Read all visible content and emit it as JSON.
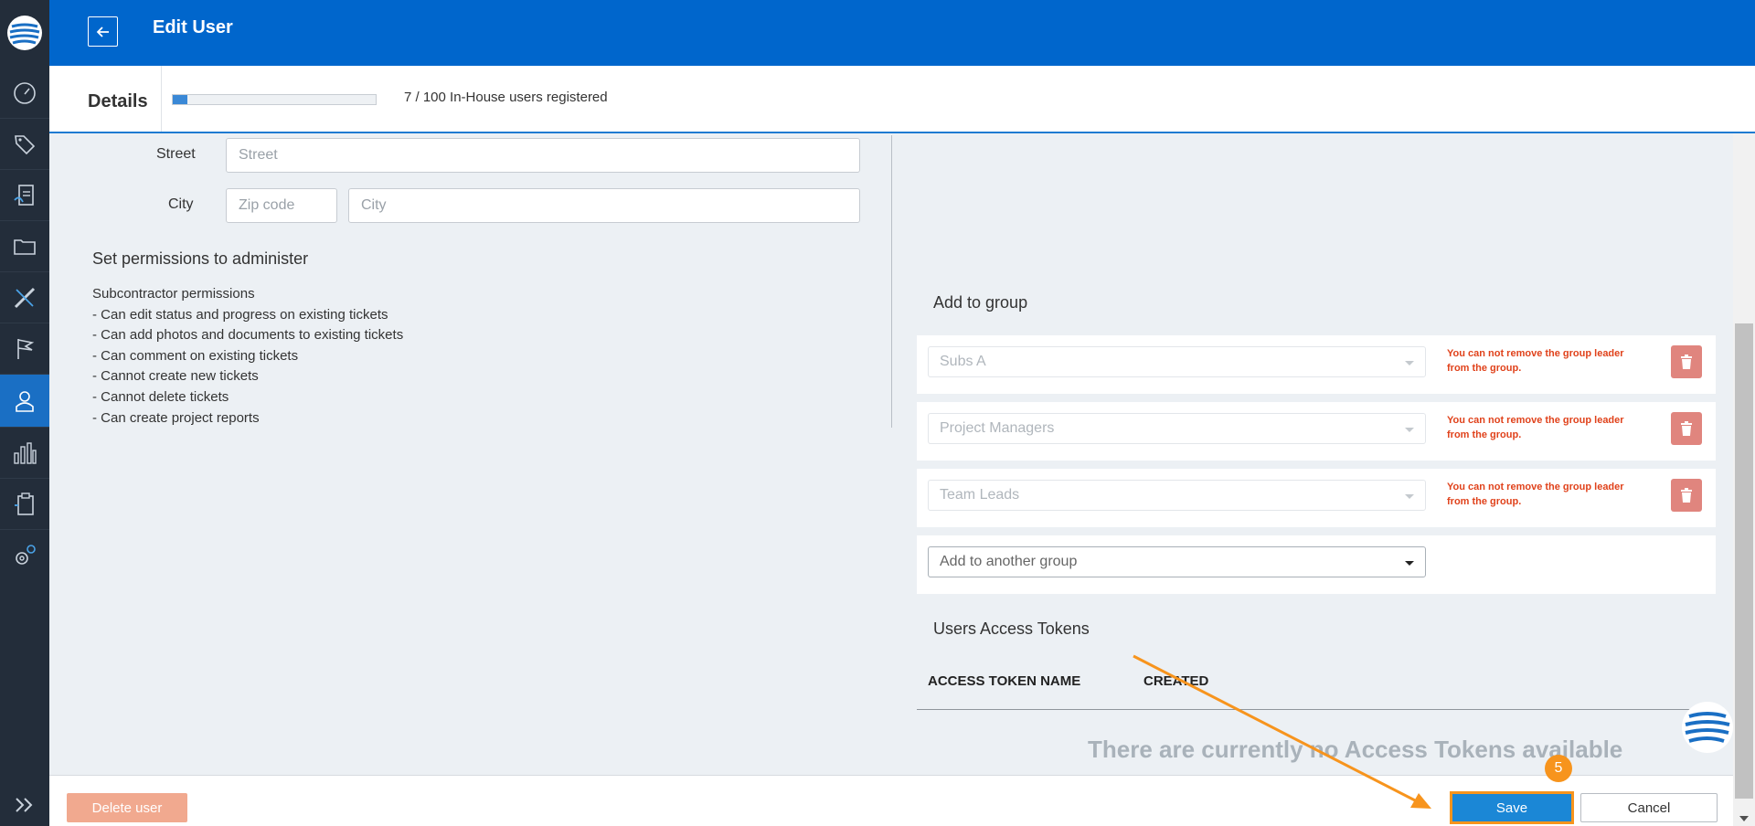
{
  "sidebar": {
    "items": [
      {
        "icon": "dashboard-gauge-icon"
      },
      {
        "icon": "tags-icon"
      },
      {
        "icon": "plans-document-icon"
      },
      {
        "icon": "folder-icon"
      },
      {
        "icon": "ruler-pencil-icon"
      },
      {
        "icon": "flag-icon"
      },
      {
        "icon": "user-icon",
        "active": true
      },
      {
        "icon": "statistics-bars-icon"
      },
      {
        "icon": "clipboard-icon"
      },
      {
        "icon": "settings-gears-icon"
      }
    ]
  },
  "header": {
    "title": "Edit User"
  },
  "details": {
    "label": "Details",
    "registered_text": "7 / 100 In-House users registered",
    "registered_fraction": 0.07
  },
  "address": {
    "street_label": "Street",
    "street_placeholder": "Street",
    "city_label": "City",
    "zip_placeholder": "Zip code",
    "city_placeholder": "City"
  },
  "permissions": {
    "title": "Set permissions to administer",
    "lines": [
      "Subcontractor permissions",
      "- Can edit status and progress on existing tickets",
      "- Can add photos and documents to existing tickets",
      "- Can comment on existing tickets",
      "- Cannot create new tickets",
      "- Cannot delete tickets",
      "- Can create project reports"
    ]
  },
  "groups": {
    "title": "Add to group",
    "rows": [
      {
        "name": "Subs A",
        "warning": "You can not remove the group leader from the group."
      },
      {
        "name": "Project Managers",
        "warning": "You can not remove the group leader from the group."
      },
      {
        "name": "Team Leads",
        "warning": "You can not remove the group leader from the group."
      }
    ],
    "add_placeholder": "Add to another group"
  },
  "tokens": {
    "title": "Users Access Tokens",
    "columns": [
      "ACCESS TOKEN NAME",
      "CREATED"
    ],
    "empty_message": "There are currently no Access Tokens available"
  },
  "footer": {
    "delete_label": "Delete user",
    "save_label": "Save",
    "cancel_label": "Cancel"
  },
  "annotation": {
    "step": "5",
    "color": "#f7941d"
  }
}
